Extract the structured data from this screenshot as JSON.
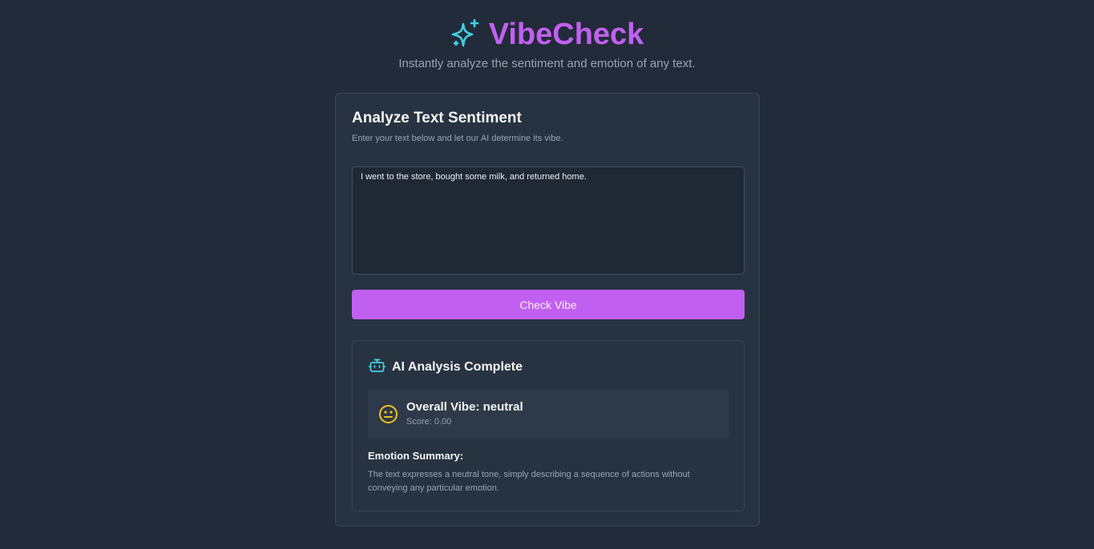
{
  "app": {
    "title": "VibeCheck",
    "subtitle": "Instantly analyze the sentiment and emotion of any text.",
    "logo_icon": "sparkles-icon",
    "accent_color": "#c160f0",
    "icon_color": "#3fd2e8"
  },
  "analyzer": {
    "title": "Analyze Text Sentiment",
    "description": "Enter your text below and let our AI determine its vibe.",
    "input_value": "I went to the store, bought some milk, and returned home.",
    "button_label": "Check Vibe"
  },
  "result": {
    "icon": "robot-icon",
    "title": "AI Analysis Complete",
    "vibe_icon": "neutral-face-icon",
    "vibe_label": "Overall Vibe: neutral",
    "score_text": "Score: 0.00",
    "emotion_heading": "Emotion Summary:",
    "emotion_text": "The text expresses a neutral tone, simply describing a sequence of actions without conveying any particular emotion."
  }
}
